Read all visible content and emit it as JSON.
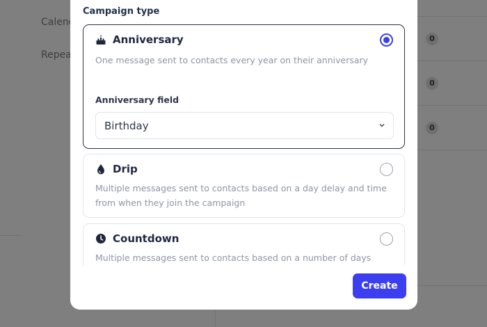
{
  "background": {
    "labels": [
      "Calend",
      "Repea"
    ],
    "badges": [
      "0",
      "0",
      "0"
    ]
  },
  "modal": {
    "section_title": "Campaign type",
    "options": [
      {
        "icon": "cake-icon",
        "name": "Anniversary",
        "description": "One message sent to contacts every year on their anniversary",
        "selected": true
      },
      {
        "icon": "drop-icon",
        "name": "Drip",
        "description": "Multiple messages sent to contacts based on a day delay and time from when they join the campaign",
        "selected": false
      },
      {
        "icon": "clock-icon",
        "name": "Countdown",
        "description": "Multiple messages sent to contacts based on a number of days and time",
        "selected": false
      }
    ],
    "anniversary_field": {
      "label": "Anniversary field",
      "value": "Birthday"
    },
    "create_label": "Create"
  },
  "colors": {
    "accent": "#3c3ff0",
    "overlay": "#7f7f7f"
  }
}
